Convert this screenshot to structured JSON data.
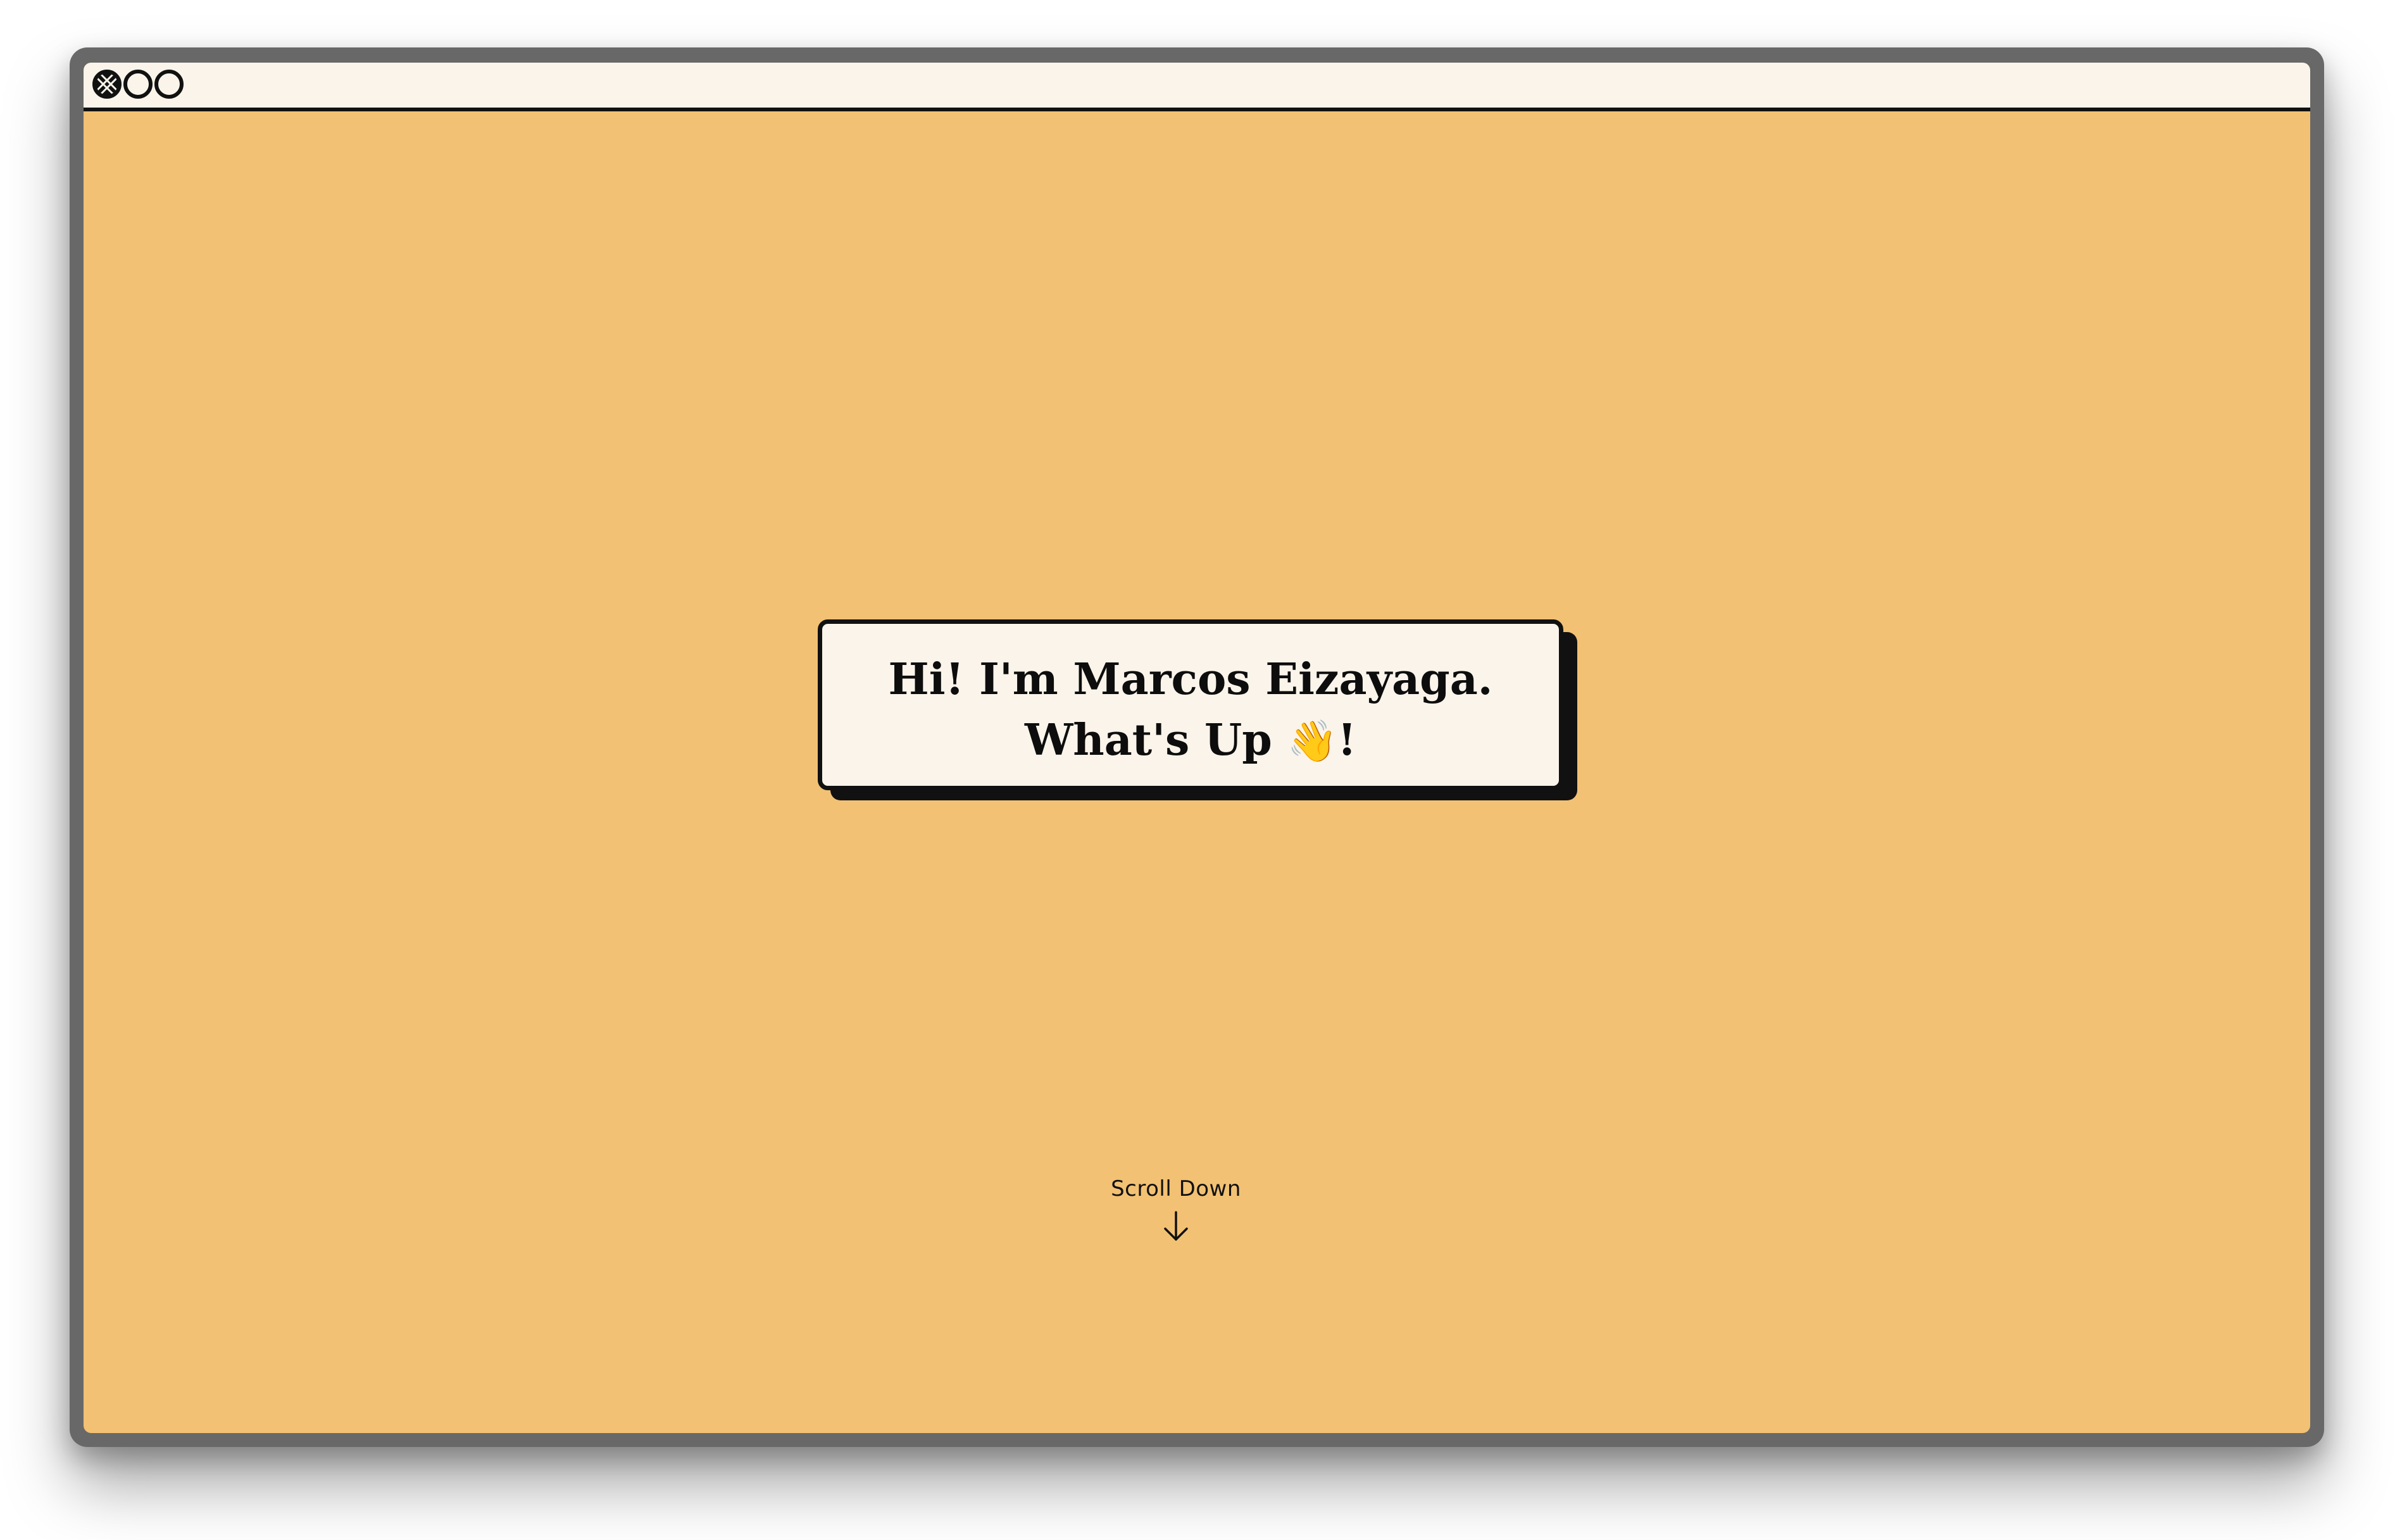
{
  "window": {
    "controls": {
      "close": "close-icon",
      "minimize": "minimize-icon",
      "maximize": "maximize-icon"
    }
  },
  "hero": {
    "line1": "Hi! I'm Marcos Eizayaga.",
    "line2_prefix": "What's Up ",
    "wave_emoji": "👋",
    "line2_suffix": "!"
  },
  "scroll_hint": {
    "label": "Scroll Down",
    "icon": "arrow-down-icon"
  },
  "colors": {
    "background": "#f2c173",
    "card": "#faf4ea",
    "ink": "#111111",
    "frame": "#686868"
  }
}
